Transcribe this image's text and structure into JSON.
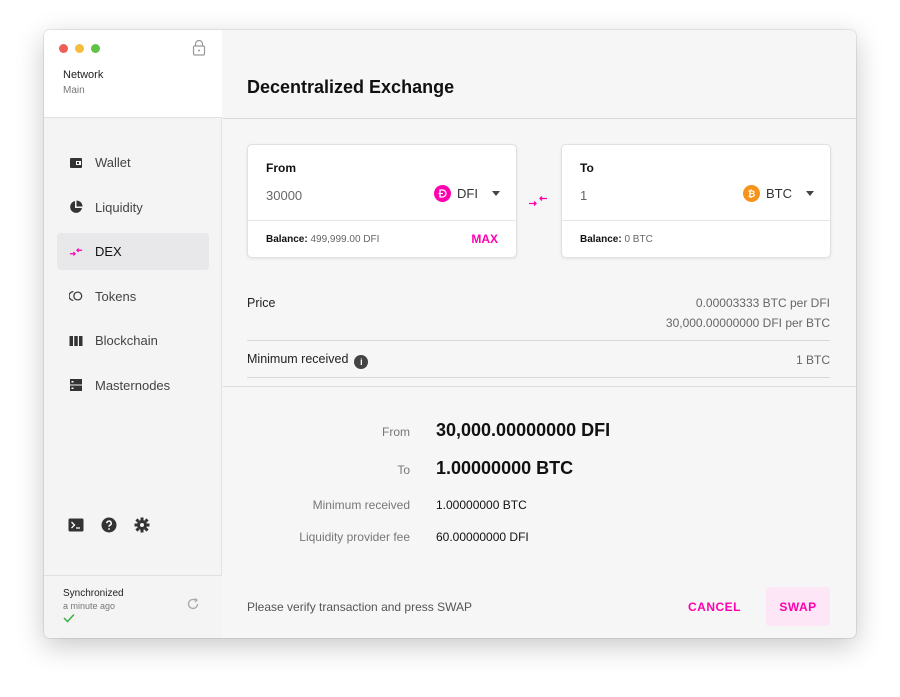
{
  "network": {
    "label": "Network",
    "value": "Main"
  },
  "sidebar": {
    "items": [
      {
        "label": "Wallet",
        "icon": "wallet-icon"
      },
      {
        "label": "Liquidity",
        "icon": "pie-chart-icon"
      },
      {
        "label": "DEX",
        "icon": "swap-arrows-icon",
        "active": true
      },
      {
        "label": "Tokens",
        "icon": "tokens-icon"
      },
      {
        "label": "Blockchain",
        "icon": "blockchain-icon"
      },
      {
        "label": "Masternodes",
        "icon": "server-icon"
      }
    ]
  },
  "sync": {
    "title": "Synchronized",
    "time": "a minute ago"
  },
  "page": {
    "title": "Decentralized Exchange"
  },
  "from_card": {
    "label": "From",
    "amount": "30000",
    "token": "DFI",
    "balance_label": "Balance:",
    "balance_value": "499,999.00 DFI",
    "max_label": "MAX"
  },
  "to_card": {
    "label": "To",
    "amount": "1",
    "token": "BTC",
    "balance_label": "Balance:",
    "balance_value": "0 BTC"
  },
  "price": {
    "label": "Price",
    "line1": "0.00003333 BTC per DFI",
    "line2": "30,000.00000000 DFI per BTC"
  },
  "minimum": {
    "label": "Minimum received",
    "value": "1 BTC"
  },
  "summary": {
    "from_label": "From",
    "from_value": "30,000.00000000 DFI",
    "to_label": "To",
    "to_value": "1.00000000 BTC",
    "min_label": "Minimum received",
    "min_value": "1.00000000 BTC",
    "fee_label": "Liquidity provider fee",
    "fee_value": "60.00000000 DFI"
  },
  "footer": {
    "note": "Please verify transaction and press SWAP",
    "cancel_label": "CANCEL",
    "swap_label": "SWAP"
  },
  "colors": {
    "accent": "#ff00af",
    "btc": "#f7931a",
    "swap_bg": "#fde6f5"
  }
}
